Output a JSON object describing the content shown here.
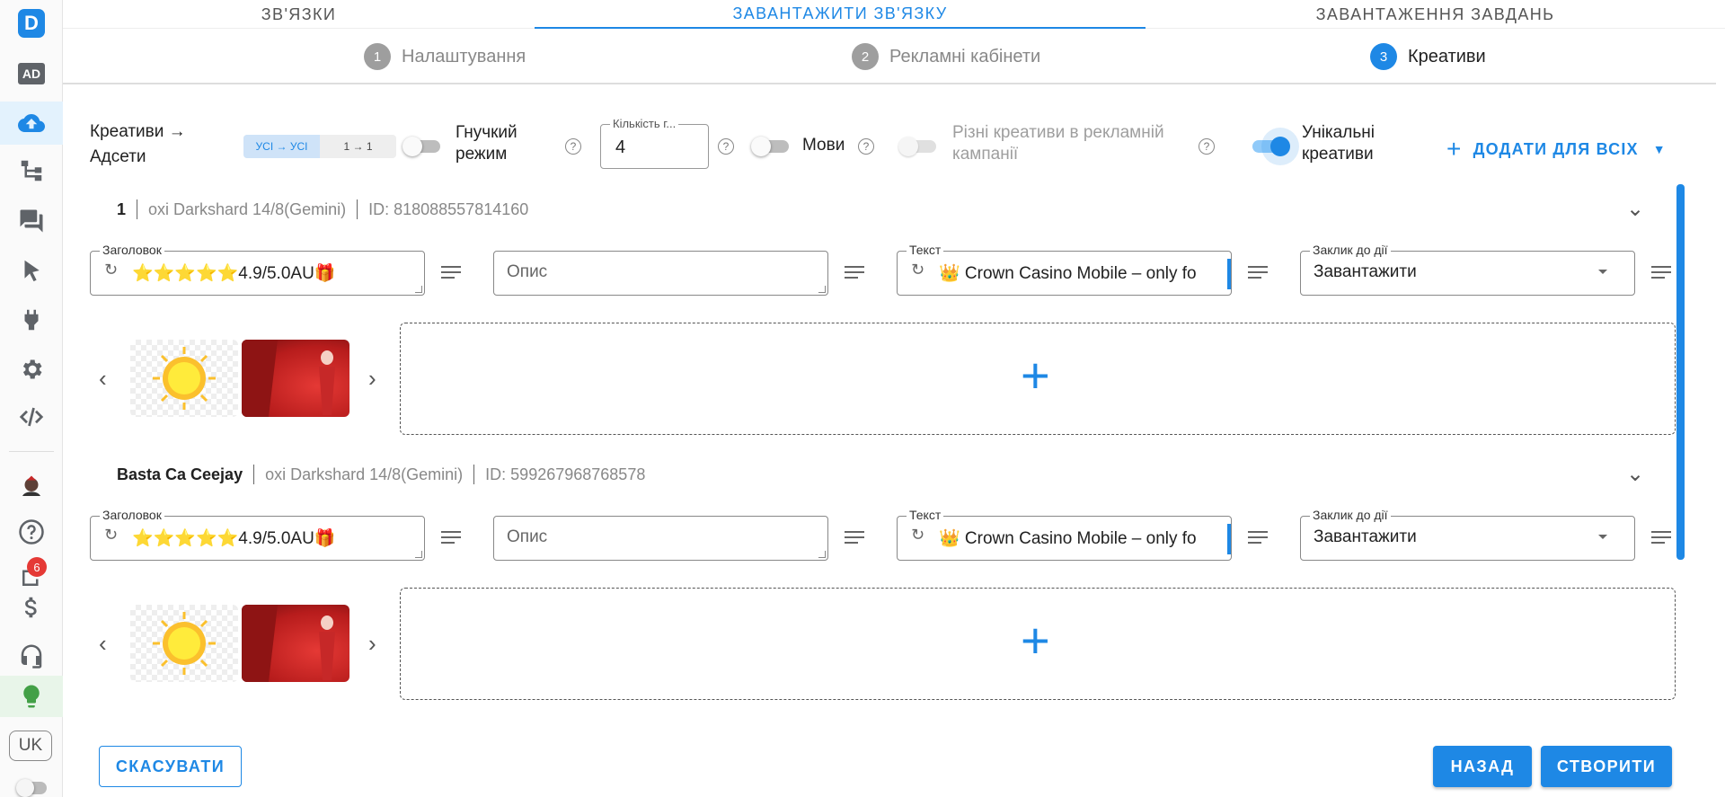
{
  "sidebar": {
    "logo": "D",
    "ad_label": "AD",
    "badge_count": "6",
    "lang": "UK",
    "icons": [
      "upload-cloud-icon",
      "hierarchy-icon",
      "chat-icon",
      "cursor-icon",
      "plug-icon",
      "gear-icon",
      "code-icon",
      "avatar-icon",
      "help-icon",
      "report-icon",
      "dollar-icon",
      "headset-icon",
      "bulb-icon"
    ]
  },
  "tabs": [
    {
      "label": "ЗВ'ЯЗКИ",
      "active": false
    },
    {
      "label": "ЗАВАНТАЖИТИ ЗВ'ЯЗКУ",
      "active": true
    },
    {
      "label": "ЗАВАНТАЖЕННЯ ЗАВДАНЬ",
      "active": false
    }
  ],
  "stepper": [
    {
      "num": "1",
      "label": "Налаштування"
    },
    {
      "num": "2",
      "label": "Рекламні кабінети"
    },
    {
      "num": "3",
      "label": "Креативи"
    }
  ],
  "controls": {
    "mapping_label_1": "Креативи →",
    "mapping_label_2": "Адсети",
    "seg_all": "УСІ → УСІ",
    "seg_one": "1 → 1",
    "flex_mode_1": "Гнучкий",
    "flex_mode_2": "режим",
    "count_label": "Кількість г...",
    "count_value": "4",
    "languages": "Мови",
    "diff_creatives_1": "Різні креативи в рекламній",
    "diff_creatives_2": "кампанії",
    "unique_1": "Унікальні",
    "unique_2": "креативи",
    "add_all": "ДОДАТИ ДЛЯ ВСІХ"
  },
  "help_mark": "?",
  "groups": [
    {
      "name": "1",
      "account": "oxi Darkshard 14/8(Gemini)",
      "id": "ID: 818088557814160",
      "headline_label": "Заголовок",
      "headline_value": "⭐⭐⭐⭐⭐4.9/5.0AU🎁",
      "desc_placeholder": "Опис",
      "text_label": "Текст",
      "text_value": "👑 Crown Casino Mobile – only fo",
      "cta_label": "Заклик до дії",
      "cta_value": "Завантажити"
    },
    {
      "name": "Basta Ca Ceejay",
      "account": "oxi Darkshard 14/8(Gemini)",
      "id": "ID: 599267968768578",
      "headline_label": "Заголовок",
      "headline_value": "⭐⭐⭐⭐⭐4.9/5.0AU🎁",
      "desc_placeholder": "Опис",
      "text_label": "Текст",
      "text_value": "👑 Crown Casino Mobile – only fo",
      "cta_label": "Заклик до дії",
      "cta_value": "Завантажити"
    }
  ],
  "footer": {
    "cancel": "СКАСУВАТИ",
    "back": "НАЗАД",
    "create": "СТВОРИТИ"
  },
  "colors": {
    "accent": "#1e88e5",
    "badge": "#e53935"
  }
}
